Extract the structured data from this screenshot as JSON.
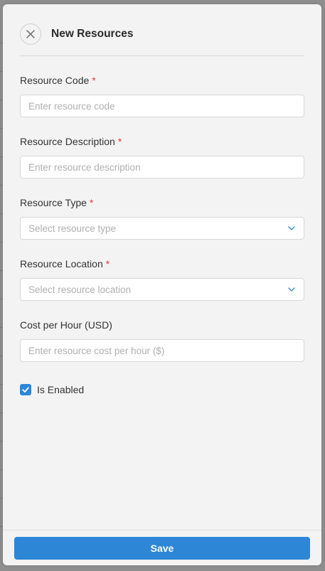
{
  "panel": {
    "title": "New Resources",
    "close_icon": "close-icon"
  },
  "fields": {
    "resource_code": {
      "label": "Resource Code",
      "required_mark": "*",
      "placeholder": "Enter resource code",
      "value": ""
    },
    "resource_description": {
      "label": "Resource Description",
      "required_mark": "*",
      "placeholder": "Enter resource description",
      "value": ""
    },
    "resource_type": {
      "label": "Resource Type",
      "required_mark": "*",
      "placeholder": "Select resource type",
      "selected": "",
      "icon": "chevron-down-icon"
    },
    "resource_location": {
      "label": "Resource Location",
      "required_mark": "*",
      "placeholder": "Select resource location",
      "selected": "",
      "icon": "chevron-down-icon"
    },
    "cost_per_hour": {
      "label": "Cost per Hour (USD)",
      "placeholder": "Enter resource cost per hour ($)",
      "value": ""
    }
  },
  "is_enabled": {
    "label": "Is Enabled",
    "checked": true
  },
  "footer": {
    "save_label": "Save"
  },
  "colors": {
    "accent": "#2d87d6",
    "required": "#e53935",
    "panel_bg": "#f3f3f3"
  }
}
